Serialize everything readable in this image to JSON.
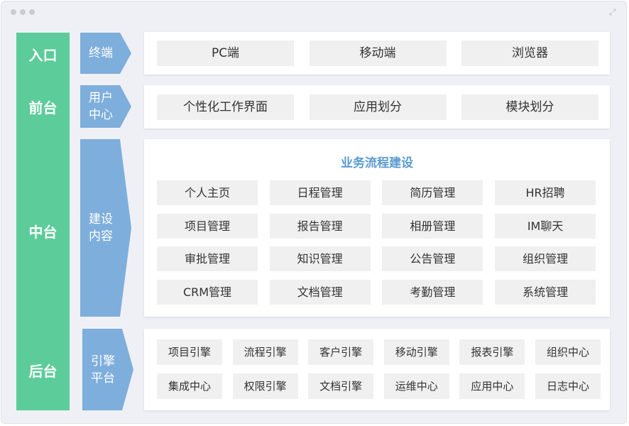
{
  "colors": {
    "green": "#5ccc9a",
    "blue": "#7eaedb",
    "title_blue": "#5b9bcf",
    "cell_bg": "#f0f0f0"
  },
  "window": {
    "controls": [
      "close-dot",
      "minimize-dot",
      "zoom-dot"
    ],
    "expand_icon": "expand-icon"
  },
  "layers": [
    {
      "id": "entry",
      "name": "入口",
      "sub": [
        "终端"
      ],
      "items": [
        "PC端",
        "移动端",
        "浏览器"
      ]
    },
    {
      "id": "front",
      "name": "前台",
      "sub": [
        "用户",
        "中心"
      ],
      "items": [
        "个性化工作界面",
        "应用划分",
        "模块划分"
      ]
    },
    {
      "id": "middle",
      "name": "中台",
      "sub": [
        "建设",
        "内容"
      ],
      "title": "业务流程建设",
      "items": [
        "个人主页",
        "日程管理",
        "简历管理",
        "HR招聘",
        "项目管理",
        "报告管理",
        "相册管理",
        "IM聊天",
        "审批管理",
        "知识管理",
        "公告管理",
        "组织管理",
        "CRM管理",
        "文档管理",
        "考勤管理",
        "系统管理"
      ]
    },
    {
      "id": "back",
      "name": "后台",
      "sub": [
        "引擎",
        "平台"
      ],
      "items": [
        "项目引擎",
        "流程引擎",
        "客户引擎",
        "移动引擎",
        "报表引擎",
        "组织中心",
        "集成中心",
        "权限引擎",
        "文档引擎",
        "运维中心",
        "应用中心",
        "日志中心"
      ]
    }
  ]
}
